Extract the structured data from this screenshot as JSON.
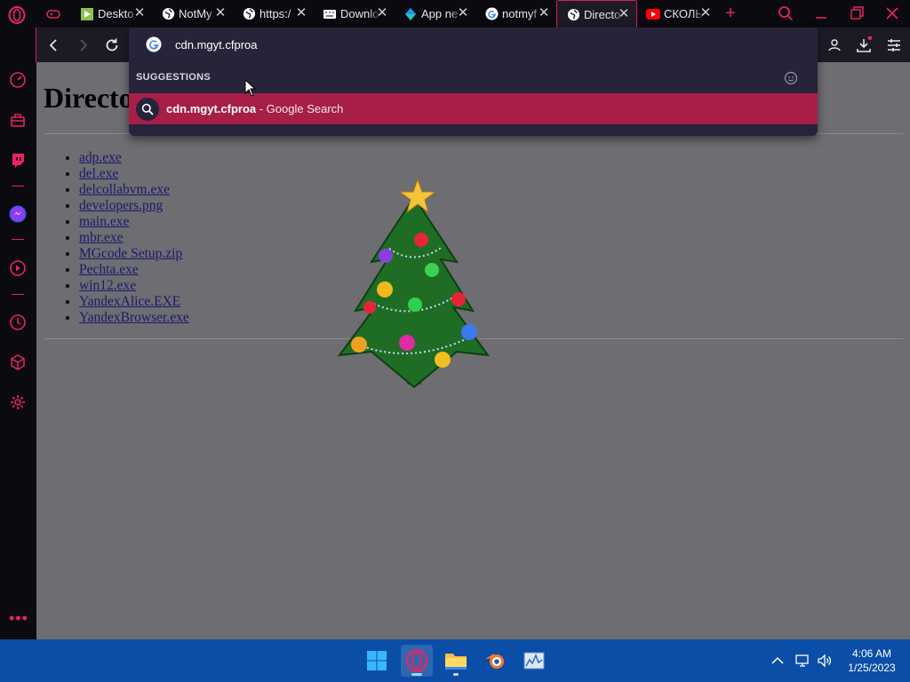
{
  "browser": {
    "tabs": [
      {
        "title": "Deskto",
        "icon": "green-bookmark-icon"
      },
      {
        "title": "NotMy",
        "icon": "globe-icon"
      },
      {
        "title": "https:/",
        "icon": "globe-icon"
      },
      {
        "title": "Downlo",
        "icon": "keyboard-icon"
      },
      {
        "title": "App ne",
        "icon": "diamond-icon"
      },
      {
        "title": "notmyf",
        "icon": "google-icon"
      },
      {
        "title": "Directo",
        "icon": "globe-icon",
        "active": true
      },
      {
        "title": "СКОЛЬ",
        "icon": "youtube-icon"
      }
    ],
    "accent_color": "#e8245e"
  },
  "omnibox": {
    "value": "cdn.mgyt.cfproa",
    "suggestions_header": "SUGGESTIONS",
    "suggestion": {
      "bold": "cdn.mgyt.cfproa",
      "rest": " - Google Search"
    }
  },
  "page": {
    "title": "Directo",
    "files": [
      "adp.exe",
      "del.exe",
      "delcollabvm.exe",
      "developers.png",
      "main.exe",
      "mbr.exe",
      "MGcode Setup.zip",
      "Pechta.exe",
      "win12.exe",
      "YandexAlice.EXE",
      "YandexBrowser.exe"
    ]
  },
  "taskbar": {
    "apps": [
      "windows-start-icon",
      "opera-icon",
      "file-explorer-icon",
      "blender-icon",
      "task-manager-icon"
    ],
    "time": "4:06 AM",
    "date": "1/25/2023"
  }
}
